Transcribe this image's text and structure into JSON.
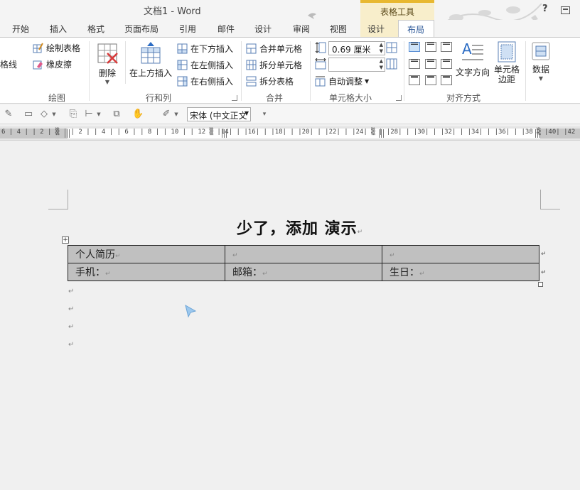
{
  "window": {
    "title": "文档1 - Word",
    "context_tool": "表格工具",
    "help": "?"
  },
  "tabs": [
    {
      "label": "开始"
    },
    {
      "label": "插入"
    },
    {
      "label": "格式"
    },
    {
      "label": "页面布局"
    },
    {
      "label": "引用"
    },
    {
      "label": "邮件"
    },
    {
      "label": "设计"
    },
    {
      "label": "审阅"
    },
    {
      "label": "视图"
    },
    {
      "label": "设计"
    },
    {
      "label": "布局"
    }
  ],
  "ribbon": {
    "draw": {
      "gridlines": "格线",
      "draw_table": "绘制表格",
      "eraser": "橡皮擦",
      "label": "绘图"
    },
    "rows_cols": {
      "delete": "删除",
      "insert_above": "在上方插入",
      "insert_below": "在下方插入",
      "insert_left": "在左侧插入",
      "insert_right": "在右侧插入",
      "label": "行和列"
    },
    "merge": {
      "merge_cells": "合并单元格",
      "split_cells": "拆分单元格",
      "split_table": "拆分表格",
      "label": "合并"
    },
    "cell_size": {
      "height_value": "0.69 厘米",
      "autofit": "自动调整",
      "label": "单元格大小"
    },
    "alignment": {
      "text_direction": "文字方向",
      "cell_margins_line1": "单元格",
      "cell_margins_line2": "边距",
      "label": "对齐方式"
    },
    "data": {
      "label": "数据"
    }
  },
  "toolbar": {
    "font_name": "宋体 (中文正文"
  },
  "ruler": {
    "text": "6 | 4 |  | 2 |    ▒ | | 2 | | 4 | | 6 | | 8 | | 10 |  | 12 ▒ |14| | |16| | |18| | |20| | |22| | |24| ▒ | |28| | |30| | |32| | |34| | |36| | |38 ▒ |40| |42"
  },
  "document": {
    "title": "少了，添加  演示",
    "table": [
      [
        "个人简历",
        "",
        ""
      ],
      [
        "手机：",
        "邮箱：",
        "生日："
      ]
    ]
  }
}
